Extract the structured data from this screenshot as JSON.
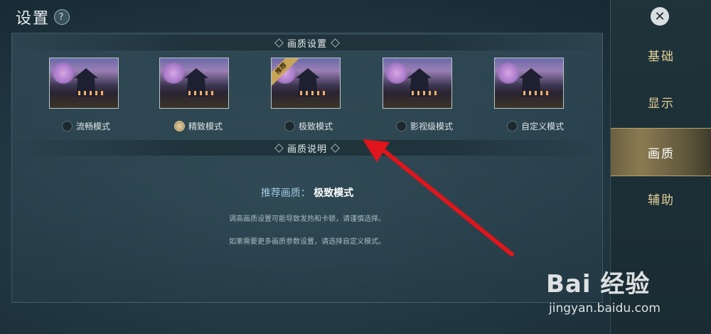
{
  "header": {
    "title": "设置",
    "help_icon": "question-icon"
  },
  "section_quality": {
    "header": "画质设置"
  },
  "presets": [
    {
      "label": "流畅模式",
      "selected": false,
      "recommended": false
    },
    {
      "label": "精致模式",
      "selected": true,
      "recommended": false
    },
    {
      "label": "极致模式",
      "selected": false,
      "recommended": true,
      "badge": "推荐"
    },
    {
      "label": "影视级模式",
      "selected": false,
      "recommended": false
    },
    {
      "label": "自定义模式",
      "selected": false,
      "recommended": false
    }
  ],
  "section_desc": {
    "header": "画质说明",
    "recommend_label": "推荐画质：",
    "recommend_value": "极致模式",
    "line1": "调高画质设置可能导致发热和卡顿，请谨慎选择。",
    "line2": "如果需要更多画质参数设置，请选择自定义模式。"
  },
  "sidebar": {
    "close_icon": "close-icon",
    "tabs": [
      {
        "label": "基础",
        "active": false
      },
      {
        "label": "显示",
        "active": false
      },
      {
        "label": "画质",
        "active": true
      },
      {
        "label": "辅助",
        "active": false
      }
    ]
  },
  "watermark": {
    "logo": "Bai 经验",
    "sub": "jingyan.baidu.com"
  },
  "colors": {
    "accent_gold": "#e3cf96",
    "arrow_red": "#e0151b",
    "recommend_label": "#9ec8dc"
  }
}
